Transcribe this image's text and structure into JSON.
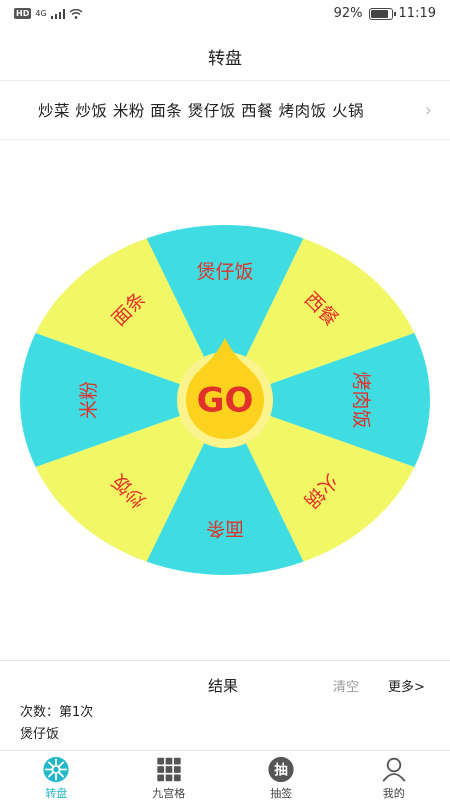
{
  "status_bar": {
    "network": "4G",
    "battery_percent": "92%",
    "battery_level": 0.92,
    "time": "11:19"
  },
  "header": {
    "title": "转盘"
  },
  "options": {
    "summary": "炒菜 炒饭 米粉 面条 煲仔饭 西餐 烤肉饭 火锅"
  },
  "wheel": {
    "center_label": "GO",
    "colors": {
      "cyan": "#3fdde2",
      "yellow": "#f2f766",
      "center_ring": "#fbf38b",
      "center": "#fcd21f",
      "text": "#e0322a"
    },
    "segments": [
      {
        "label": "煲仔饭",
        "color": "cyan"
      },
      {
        "label": "西餐",
        "color": "yellow"
      },
      {
        "label": "烤肉饭",
        "color": "cyan"
      },
      {
        "label": "火锅",
        "color": "yellow"
      },
      {
        "label": "面条",
        "color": "cyan"
      },
      {
        "label": "炒饭",
        "color": "yellow"
      },
      {
        "label": "米粉",
        "color": "cyan"
      },
      {
        "label": "面条",
        "color": "yellow"
      }
    ]
  },
  "results": {
    "title": "结果",
    "clear_label": "清空",
    "more_label": "更多>",
    "count_text": "次数：第1次",
    "value_text": "煲仔饭"
  },
  "tabs": [
    {
      "label": "转盘",
      "icon": "wheel-icon",
      "active": true
    },
    {
      "label": "九宫格",
      "icon": "grid-icon",
      "active": false
    },
    {
      "label": "抽签",
      "icon": "draw-lots-icon",
      "glyph": "抽",
      "active": false
    },
    {
      "label": "我的",
      "icon": "user-icon",
      "active": false
    }
  ]
}
